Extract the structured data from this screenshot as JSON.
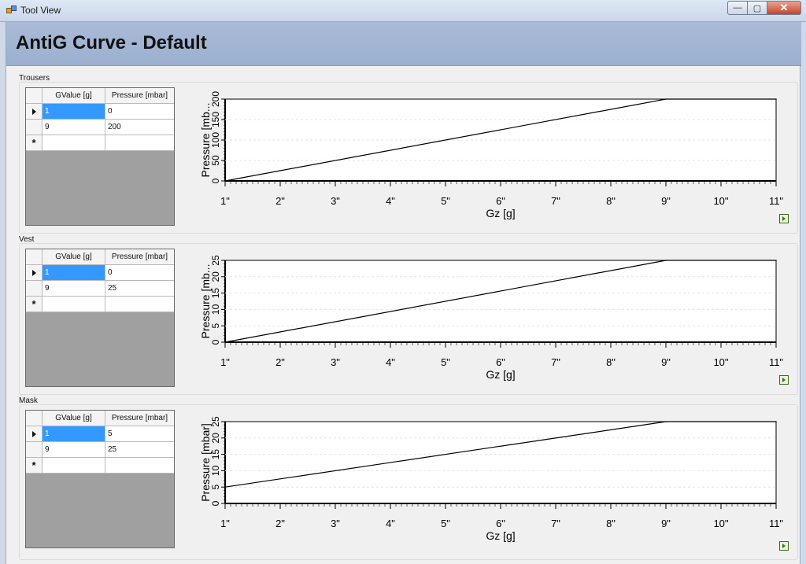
{
  "window": {
    "title": "Tool View",
    "close_label": "✕",
    "min_label": "—",
    "max_label": "▢"
  },
  "page": {
    "title": "AntiG Curve - Default"
  },
  "grid_headers": {
    "gvalue": "GValue [g]",
    "pressure": "Pressure [mbar]"
  },
  "colors": {
    "selection": "#3399ff",
    "header_band": "#a9bad6",
    "plot_line": "#000000"
  },
  "sections": [
    {
      "label": "Trousers",
      "rows": [
        {
          "g": "1",
          "p": "0"
        },
        {
          "g": "9",
          "p": "200"
        }
      ],
      "chart_data": {
        "type": "line",
        "x": [
          1,
          9,
          11
        ],
        "y": [
          0,
          200,
          200
        ],
        "xlabel": "Gz [g]",
        "ylabel": "Pressure [mb...",
        "xlim": [
          1,
          11
        ],
        "ylim": [
          0,
          200
        ],
        "xticks": [
          "1\"",
          "2\"",
          "3\"",
          "4\"",
          "5\"",
          "6\"",
          "7\"",
          "8\"",
          "9\"",
          "10\"",
          "11\""
        ],
        "yticks": [
          "0",
          "50",
          "100",
          "150",
          "200"
        ],
        "yticks_values": [
          0,
          50,
          100,
          150,
          200
        ]
      }
    },
    {
      "label": "Vest",
      "rows": [
        {
          "g": "1",
          "p": "0"
        },
        {
          "g": "9",
          "p": "25"
        }
      ],
      "chart_data": {
        "type": "line",
        "x": [
          1,
          9,
          11
        ],
        "y": [
          0,
          25,
          25
        ],
        "xlabel": "Gz [g]",
        "ylabel": "Pressure [mb...",
        "xlim": [
          1,
          11
        ],
        "ylim": [
          0,
          25
        ],
        "xticks": [
          "1\"",
          "2\"",
          "3\"",
          "4\"",
          "5\"",
          "6\"",
          "7\"",
          "8\"",
          "9\"",
          "10\"",
          "11\""
        ],
        "yticks": [
          "0",
          "5",
          "10",
          "15",
          "20",
          "25"
        ],
        "yticks_values": [
          0,
          5,
          10,
          15,
          20,
          25
        ]
      }
    },
    {
      "label": "Mask",
      "rows": [
        {
          "g": "1",
          "p": "5"
        },
        {
          "g": "9",
          "p": "25"
        }
      ],
      "chart_data": {
        "type": "line",
        "x": [
          1,
          9,
          11
        ],
        "y": [
          5,
          25,
          25
        ],
        "xlabel": "Gz [g]",
        "ylabel": "Pressure [mbar]",
        "xlim": [
          1,
          11
        ],
        "ylim": [
          0,
          25
        ],
        "xticks": [
          "1\"",
          "2\"",
          "3\"",
          "4\"",
          "5\"",
          "6\"",
          "7\"",
          "8\"",
          "9\"",
          "10\"",
          "11\""
        ],
        "yticks": [
          "0",
          "5",
          "10",
          "15",
          "20",
          "25"
        ],
        "yticks_values": [
          0,
          5,
          10,
          15,
          20,
          25
        ]
      }
    }
  ]
}
